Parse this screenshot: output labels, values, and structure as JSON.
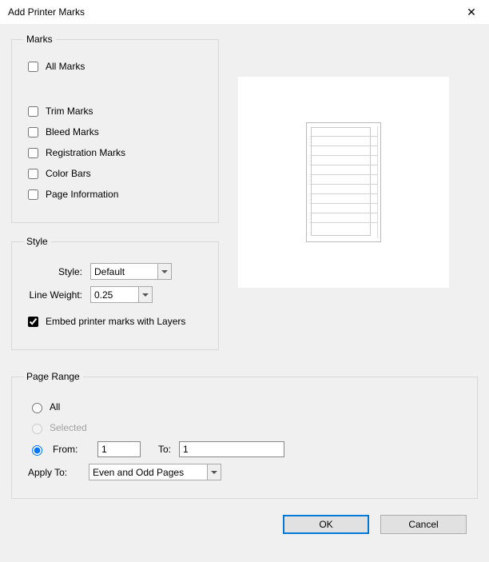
{
  "window": {
    "title": "Add Printer Marks"
  },
  "marks": {
    "legend": "Marks",
    "all": "All Marks",
    "trim": "Trim Marks",
    "bleed": "Bleed Marks",
    "registration": "Registration Marks",
    "colorbars": "Color Bars",
    "pageinfo": "Page Information"
  },
  "style": {
    "legend": "Style",
    "style_label": "Style:",
    "style_value": "Default",
    "lineweight_label": "Line Weight:",
    "lineweight_value": "0.25",
    "embed_label": "Embed printer marks with Layers",
    "embed_checked": true
  },
  "pagerange": {
    "legend": "Page Range",
    "all": "All",
    "selected": "Selected",
    "from_label": "From:",
    "from_value": "1",
    "to_label": "To:",
    "to_value": "1",
    "apply_label": "Apply To:",
    "apply_value": "Even and Odd Pages"
  },
  "buttons": {
    "ok": "OK",
    "cancel": "Cancel"
  }
}
